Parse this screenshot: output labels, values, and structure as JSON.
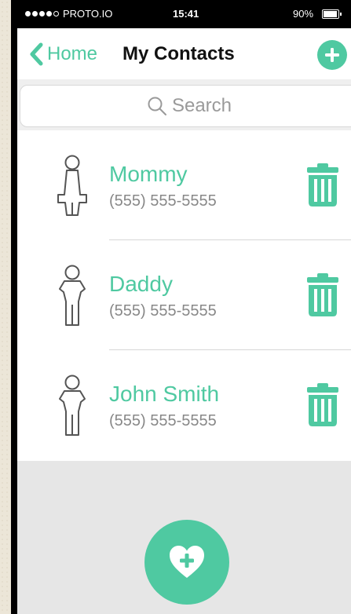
{
  "status_bar": {
    "carrier": "PROTO.IO",
    "time": "15:41",
    "battery": "90%"
  },
  "navbar": {
    "back_label": "Home",
    "title": "My Contacts"
  },
  "search": {
    "placeholder": "Search"
  },
  "contacts": [
    {
      "name": "Mommy",
      "phone": "(555) 555-5555",
      "avatar": "female-person-icon"
    },
    {
      "name": "Daddy",
      "phone": "(555) 555-5555",
      "avatar": "male-person-icon"
    },
    {
      "name": "John Smith",
      "phone": "(555) 555-5555",
      "avatar": "male-person-icon"
    }
  ],
  "colors": {
    "accent": "#4fc9a1",
    "background": "#e6e6e6"
  }
}
